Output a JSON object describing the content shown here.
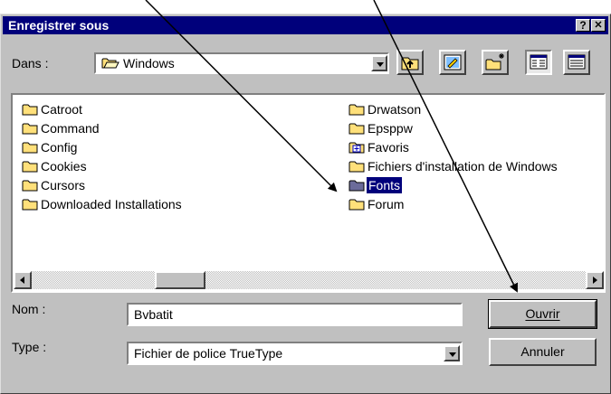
{
  "dialog": {
    "title": "Enregistrer sous",
    "help_button": "?",
    "close_button": "✕"
  },
  "location": {
    "label": "Dans :",
    "value": "Windows"
  },
  "toolbar": {
    "icons": [
      "up-one-level-icon",
      "desktop-icon",
      "new-folder-icon",
      "list-view-icon",
      "details-view-icon"
    ]
  },
  "files": {
    "left_column": [
      "Catroot",
      "Command",
      "Config",
      "Cookies",
      "Cursors",
      "Downloaded Installations"
    ],
    "right_column": [
      "Drwatson",
      "Epsppw",
      "Favoris",
      "Fichiers d'installation de Windows",
      "Fonts",
      "Forum"
    ],
    "selected": "Fonts"
  },
  "filename": {
    "label": "Nom :",
    "value": "Bvbatit"
  },
  "filetype": {
    "label": "Type :",
    "value": "Fichier de police TrueType"
  },
  "buttons": {
    "open": "Ouvrir",
    "cancel": "Annuler"
  },
  "colors": {
    "titlebar": "#00007b",
    "face": "#c0c0c0",
    "folder": "#ffe07a",
    "selection": "#00007b"
  }
}
